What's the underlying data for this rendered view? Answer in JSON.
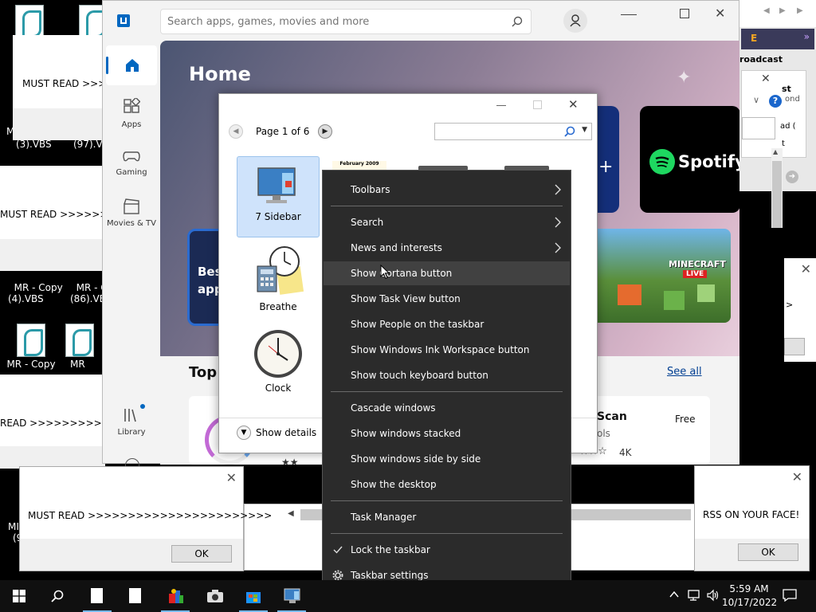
{
  "desktop": {
    "icons": [
      {
        "label": "(3).VBS"
      },
      {
        "label": "(97).VB"
      },
      {
        "label": "MR - Copy\n(4).VBS"
      },
      {
        "label": "MR - Co\n(86).VB"
      },
      {
        "label": "MR - Copy"
      },
      {
        "label": "MR"
      }
    ],
    "left_edge_fragments": [
      "M",
      "MI",
      "(9"
    ]
  },
  "message_boxes": [
    {
      "text": "MUST READ >>>>>"
    },
    {
      "text": "MUST READ >>>>>>>>>>"
    },
    {
      "text": "READ >>>>>>>>>>>>>>>"
    },
    {
      "text": "MUST READ >>>>>>>>>>>>>>>>>>>>>>>",
      "ok": "OK"
    },
    {
      "text": "RSS ON YOUR FACE!",
      "ok": "OK"
    }
  ],
  "store": {
    "search_placeholder": "Search apps, games, movies and more",
    "nav": [
      {
        "label": "Apps"
      },
      {
        "label": "Gaming"
      },
      {
        "label": "Movies & TV"
      },
      {
        "label": "Library"
      }
    ],
    "home_title": "Home",
    "best_text": "Bes\napp",
    "top_text": "Top",
    "see_all": "See all",
    "spotify": "Spotify",
    "minecraft": "MINECRAFT",
    "minecraft_sub": "LIVE",
    "card_title": "Scan",
    "card_sub": "ols",
    "card_price": "Free",
    "card_rating_count": "4K"
  },
  "right_window": {
    "tab_letter": "E",
    "text1": "roadcast",
    "text2": "st",
    "text3": "ond",
    "text4": "ad (",
    "text5": "t"
  },
  "gadgets_window": {
    "page_label": "Page 1 of 6",
    "calendar_text": "February 2009",
    "gadgets": [
      {
        "label": "7 Sidebar"
      },
      {
        "label": "Breathe"
      },
      {
        "label": "Clock"
      }
    ],
    "show_details": "Show details"
  },
  "context_menu": {
    "items": [
      {
        "label": "Toolbars",
        "submenu": true
      },
      {
        "label": "Search",
        "submenu": true
      },
      {
        "label": "News and interests",
        "submenu": true
      },
      {
        "label": "Show Cortana button"
      },
      {
        "label": "Show Task View button"
      },
      {
        "label": "Show People on the taskbar"
      },
      {
        "label": "Show Windows Ink Workspace button"
      },
      {
        "label": "Show touch keyboard button"
      },
      {
        "label": "Cascade windows"
      },
      {
        "label": "Show windows stacked"
      },
      {
        "label": "Show windows side by side"
      },
      {
        "label": "Show the desktop"
      },
      {
        "label": "Task Manager"
      },
      {
        "label": "Lock the taskbar",
        "checked": true
      },
      {
        "label": "Taskbar settings"
      }
    ]
  },
  "taskbar": {
    "time": "5:59 AM",
    "date": "10/17/2022"
  },
  "colors": {
    "taskbar": "#101010",
    "menu_bg": "#2b2b2b",
    "menu_highlight": "#414141",
    "accent": "#0067c0",
    "spotify_green": "#1ed760"
  }
}
